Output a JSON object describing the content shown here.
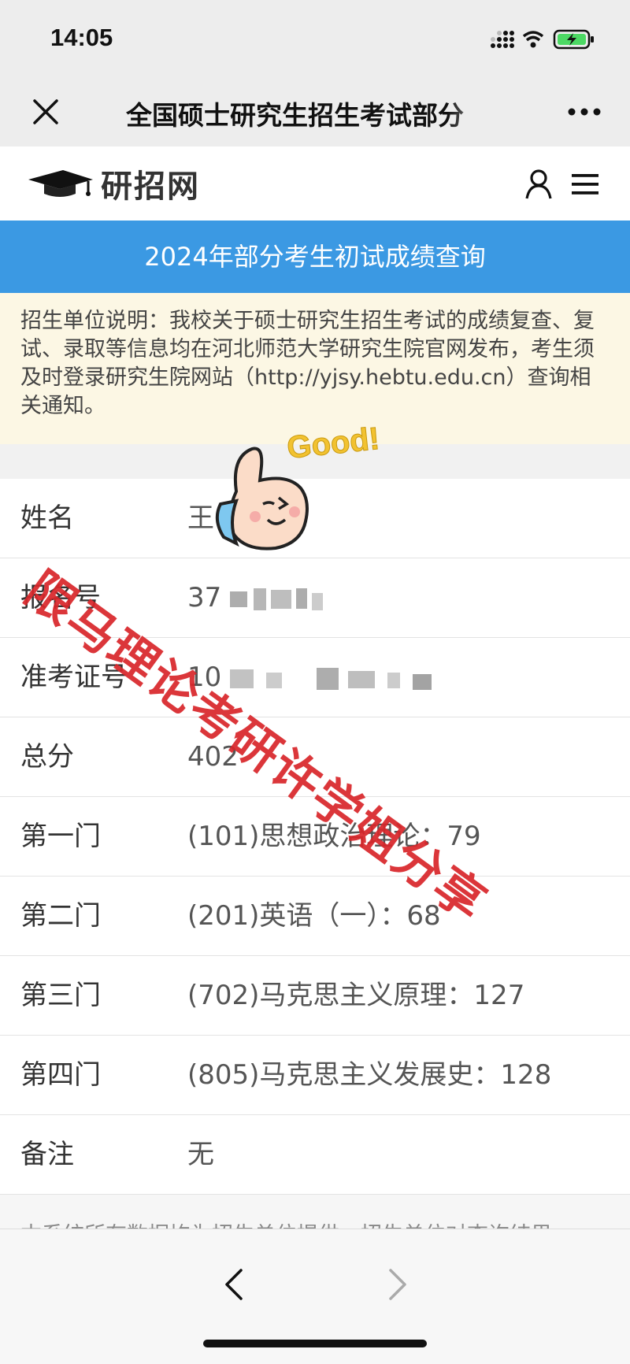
{
  "status_bar": {
    "time": "14:05"
  },
  "nav": {
    "title": "全国硕士研究生招生考试部分"
  },
  "site": {
    "logo_text": "研招网"
  },
  "banner": {
    "title": "2024年部分考生初试成绩查询"
  },
  "notice": {
    "text": "招生单位说明：我校关于硕士研究生招生考试的成绩复查、复试、录取等信息均在河北师范大学研究生院官网发布，考生须及时登录研究生院网站（http://yjsy.hebtu.edu.cn）查询相关通知。"
  },
  "results": {
    "rows": [
      {
        "label": "姓名",
        "value": "王"
      },
      {
        "label": "报名号",
        "value": "37"
      },
      {
        "label": "准考证号",
        "value": "10"
      },
      {
        "label": "总分",
        "value": "402"
      },
      {
        "label": "第一门",
        "value": "(101)思想政治理论：79"
      },
      {
        "label": "第二门",
        "value": "(201)英语（一）：68"
      },
      {
        "label": "第三门",
        "value": "(702)马克思主义原理：127"
      },
      {
        "label": "第四门",
        "value": "(805)马克思主义发展史：128"
      },
      {
        "label": "备注",
        "value": "无"
      }
    ]
  },
  "footer": {
    "text": "本系统所有数据均为招生单位提供，招生单位对查询结果"
  },
  "overlay": {
    "watermark": "限马理论考研许学姐分享",
    "sticker_text": "Good!"
  },
  "colors": {
    "banner": "#3b99e3",
    "notice_bg": "#fcf7e4",
    "watermark": "#d9262a"
  }
}
